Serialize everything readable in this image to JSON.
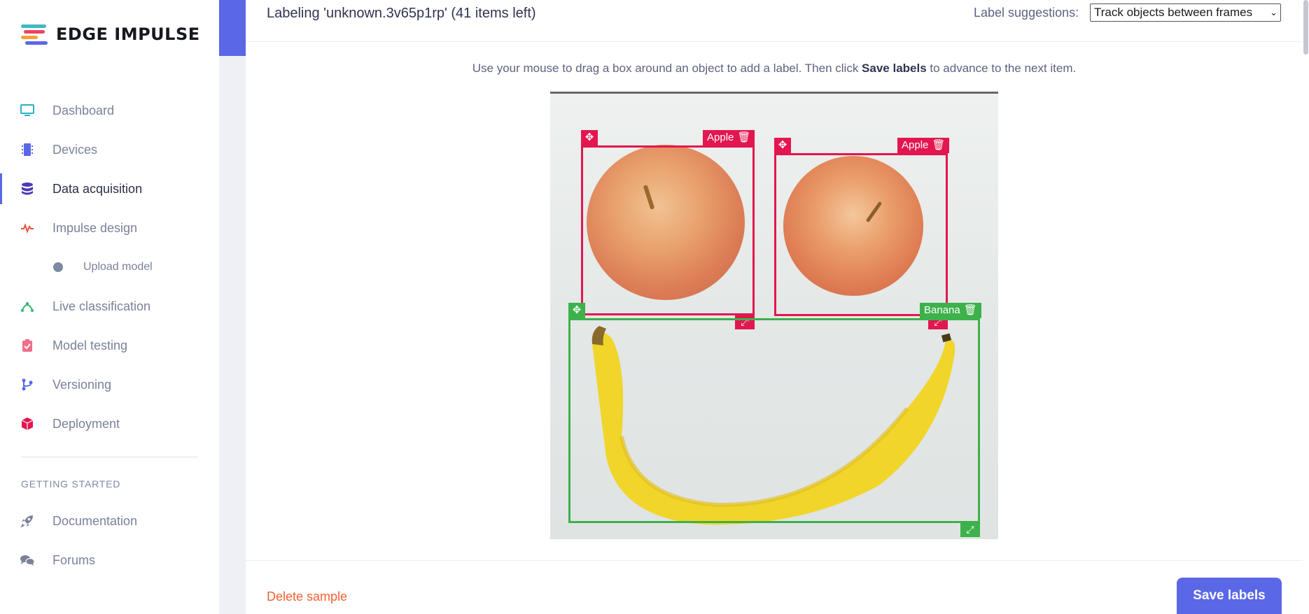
{
  "brand": {
    "name": "EDGE IMPULSE",
    "colors": [
      "#3fb8c4",
      "#e84466",
      "#f2a33c",
      "#5a67e6"
    ]
  },
  "nav": {
    "items": [
      {
        "label": "Dashboard",
        "icon": "monitor-icon",
        "color": "#2bb3c0"
      },
      {
        "label": "Devices",
        "icon": "chip-icon",
        "color": "#5a67e6"
      },
      {
        "label": "Data acquisition",
        "icon": "database-icon",
        "color": "#4b3ab6"
      },
      {
        "label": "Impulse design",
        "icon": "pulse-icon",
        "color": "#e8513a"
      },
      {
        "label": "Live classification",
        "icon": "graph-icon",
        "color": "#2fb872"
      },
      {
        "label": "Model testing",
        "icon": "clipboard-check-icon",
        "color": "#ef6e8a"
      },
      {
        "label": "Versioning",
        "icon": "branch-icon",
        "color": "#5a67e6"
      },
      {
        "label": "Deployment",
        "icon": "cube-icon",
        "color": "#e3164f"
      }
    ],
    "sub_item": {
      "label": "Upload model"
    },
    "section_title": "GETTING STARTED",
    "extra_items": [
      {
        "label": "Documentation",
        "icon": "rocket-icon"
      },
      {
        "label": "Forums",
        "icon": "chat-icon"
      }
    ]
  },
  "header": {
    "title": "Labeling 'unknown.3v65p1rp' (41 items left)",
    "suggestions_label": "Label suggestions:",
    "suggestions_value": "Track objects between frames"
  },
  "instruction": {
    "before": "Use your mouse to drag a box around an object to add a label. Then click ",
    "bold": "Save labels",
    "after": " to advance to the next item."
  },
  "boxes": [
    {
      "label": "Apple",
      "color": "#e3164f"
    },
    {
      "label": "Apple",
      "color": "#e3164f"
    },
    {
      "label": "Banana",
      "color": "#3db14a"
    }
  ],
  "footer": {
    "delete_label": "Delete sample",
    "save_label": "Save labels"
  }
}
